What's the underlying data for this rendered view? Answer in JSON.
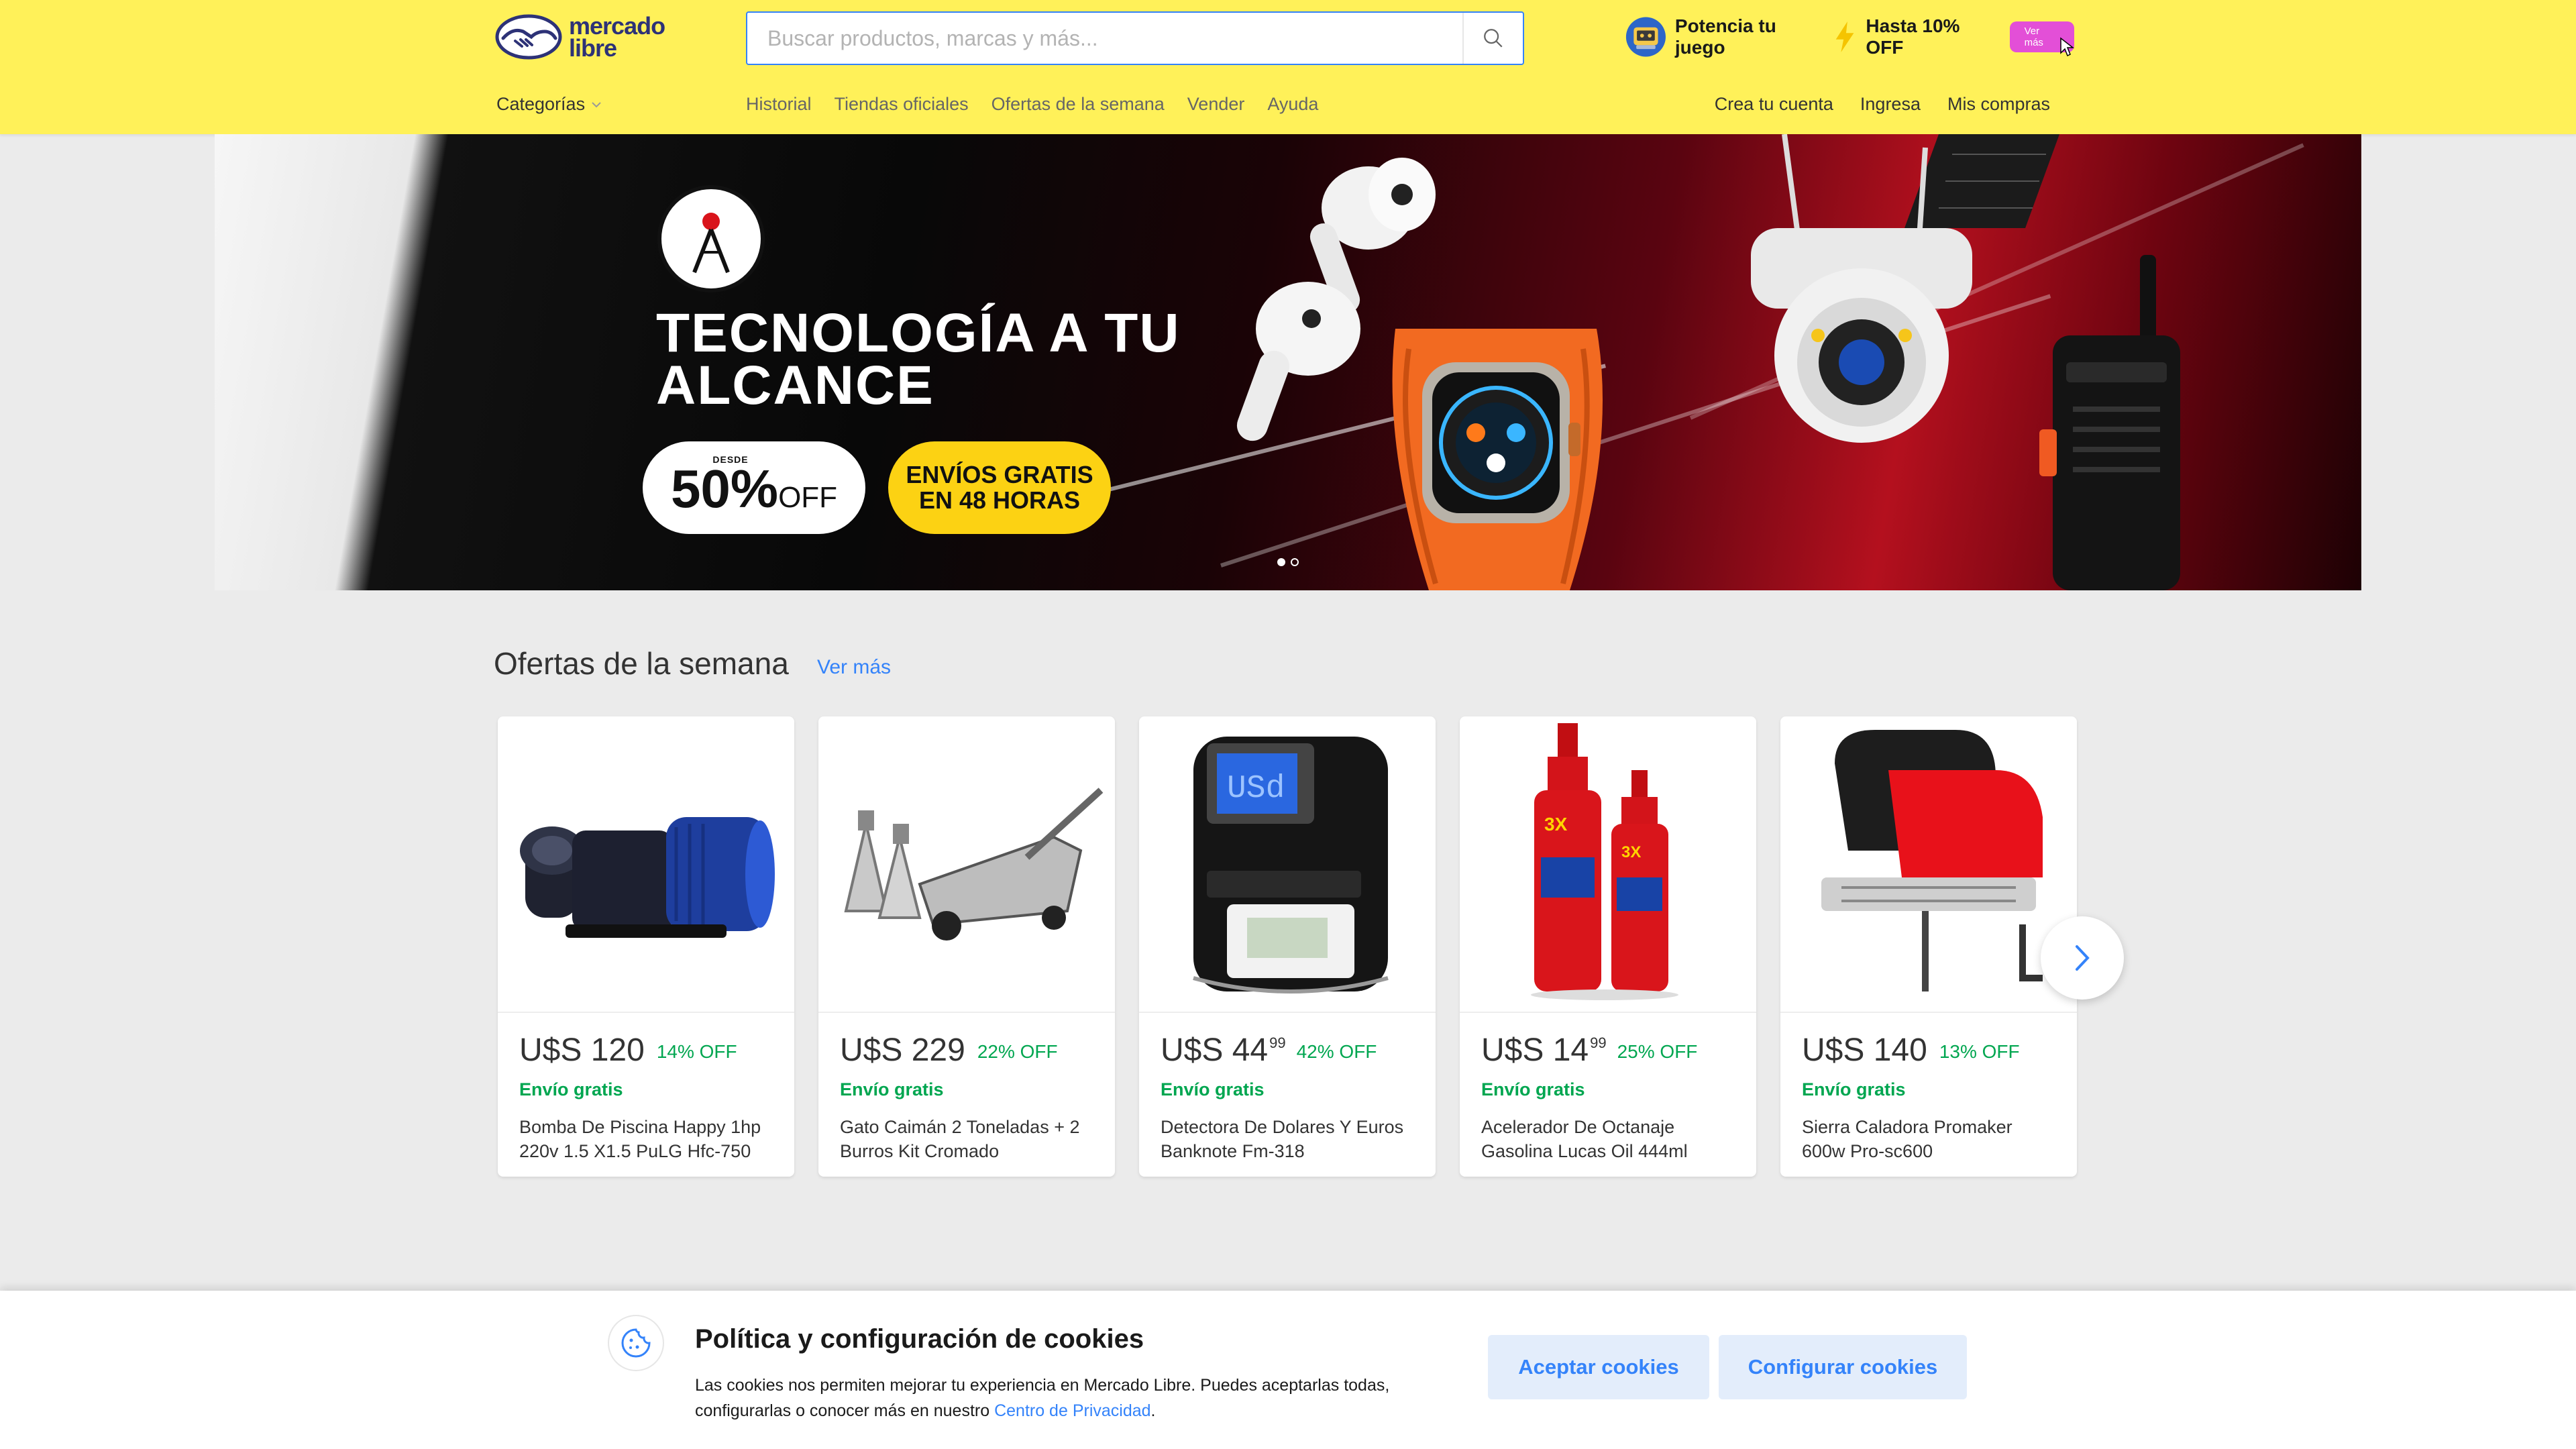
{
  "header": {
    "logo_text_line1": "mercado",
    "logo_text_line2": "libre",
    "search_placeholder": "Buscar productos, marcas y más...",
    "promo_text": "Potencia tu juego",
    "promo_offer": "Hasta 10% OFF",
    "promo_button": "Ver más",
    "brand_color": "#fff159",
    "accent_color": "#3483fa"
  },
  "nav": {
    "categories": "Categorías",
    "links": [
      "Historial",
      "Tiendas oficiales",
      "Ofertas de la semana",
      "Vender",
      "Ayuda"
    ],
    "account_links": [
      "Crea tu cuenta",
      "Ingresa",
      "Mis compras"
    ]
  },
  "hero": {
    "headline_line1": "TECNOLOGÍA A TU",
    "headline_line2": "ALCANCE",
    "discount_from": "DESDE",
    "discount_value": "50%",
    "discount_suffix": "OFF",
    "shipping_line1": "ENVÍOS GRATIS",
    "shipping_line2": "EN 48 HORAS",
    "slide_count": 2,
    "active_slide": 1
  },
  "offers": {
    "title": "Ofertas de la semana",
    "more_link": "Ver más",
    "items": [
      {
        "currency": "U$S",
        "price": "120",
        "cents": "",
        "discount": "14% OFF",
        "shipping": "Envío gratis",
        "name": "Bomba De Piscina Happy 1hp 220v 1.5 X1.5 PuLG Hfc-750",
        "icon": "pool-pump-image"
      },
      {
        "currency": "U$S",
        "price": "229",
        "cents": "",
        "discount": "22% OFF",
        "shipping": "Envío gratis",
        "name": "Gato Caimán 2 Toneladas + 2 Burros Kit Cromado",
        "icon": "floor-jack-image"
      },
      {
        "currency": "U$S",
        "price": "44",
        "cents": "99",
        "discount": "42% OFF",
        "shipping": "Envío gratis",
        "name": "Detectora De Dolares Y Euros Banknote Fm-318",
        "icon": "money-detector-image"
      },
      {
        "currency": "U$S",
        "price": "14",
        "cents": "99",
        "discount": "25% OFF",
        "shipping": "Envío gratis",
        "name": "Acelerador De Octanaje Gasolina Lucas Oil 444ml",
        "icon": "octane-booster-image"
      },
      {
        "currency": "U$S",
        "price": "140",
        "cents": "",
        "discount": "13% OFF",
        "shipping": "Envío gratis",
        "name": "Sierra Caladora Promaker 600w Pro-sc600",
        "icon": "jigsaw-image"
      }
    ]
  },
  "cookies": {
    "title": "Política y configuración de cookies",
    "description": "Las cookies nos permiten mejorar tu experiencia en Mercado Libre. Puedes aceptarlas todas, configurarlas o conocer más en nuestro ",
    "privacy_link": "Centro de Privacidad",
    "description_end": ".",
    "accept_button": "Aceptar cookies",
    "configure_button": "Configurar cookies"
  }
}
